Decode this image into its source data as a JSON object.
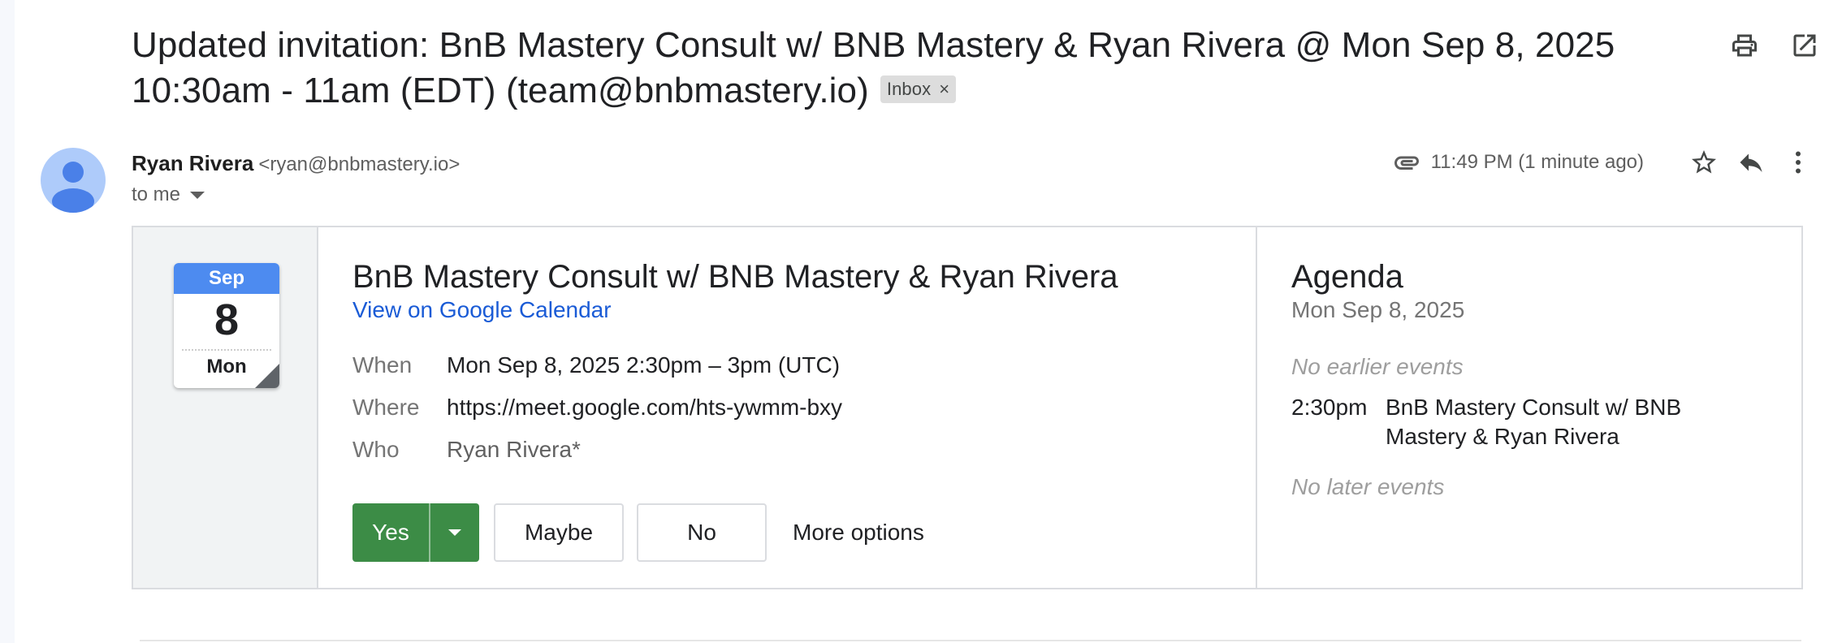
{
  "subject": {
    "text": "Updated invitation: BnB Mastery Consult w/ BNB Mastery & Ryan Rivera @ Mon Sep 8, 2025 10:30am - 11am (EDT) (team@bnbmastery.io)",
    "label_chip": "Inbox",
    "label_remove": "×"
  },
  "top_actions": [
    "print-icon",
    "open-in-new-window-icon"
  ],
  "message": {
    "sender_name": "Ryan Rivera",
    "sender_email": "<ryan@bnbmastery.io>",
    "recipient": "to me",
    "time": "11:49 PM (1 minute ago)",
    "icons": [
      "attachment-icon",
      "star-icon",
      "reply-icon",
      "more-vert-icon"
    ]
  },
  "invite": {
    "calendar": {
      "month": "Sep",
      "day": "8",
      "weekday": "Mon"
    },
    "title": "BnB Mastery Consult w/ BNB Mastery & Ryan Rivera",
    "calendar_link": "View on Google Calendar",
    "details": {
      "when_label": "When",
      "when_value": "Mon Sep 8, 2025 2:30pm – 3pm (UTC)",
      "where_label": "Where",
      "where_value": "https://meet.google.com/hts-ywmm-bxy",
      "who_label": "Who",
      "who_value": "Ryan Rivera*"
    },
    "rsvp": {
      "yes": "Yes",
      "maybe": "Maybe",
      "no": "No",
      "more": "More options",
      "yes_color": "#3c8c46"
    }
  },
  "agenda": {
    "title": "Agenda",
    "date": "Mon Sep 8, 2025",
    "no_earlier": "No earlier events",
    "item_time": "2:30pm",
    "item_title": "BnB Mastery Consult w/ BNB Mastery & Ryan Rivera",
    "no_later": "No later events"
  },
  "colors": {
    "link": "#1a5bd6",
    "calendar_header": "#4d8bf0",
    "avatar_bg": "#aecbfa",
    "avatar_fg": "#4a80e8"
  }
}
